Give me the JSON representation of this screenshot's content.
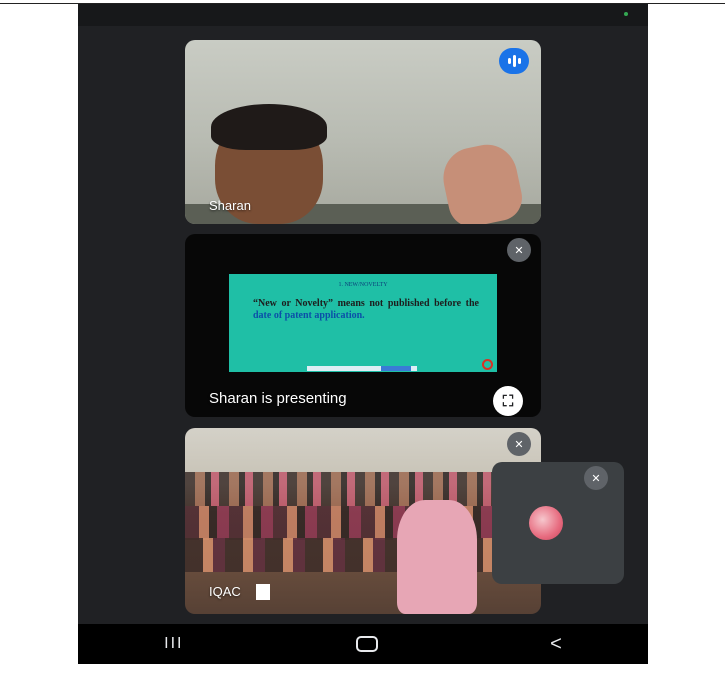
{
  "tiles": {
    "camera": {
      "participant": "Sharan"
    },
    "presentation": {
      "label": "Sharan is presenting",
      "slide": {
        "title": "1. NEW/NOVELTY",
        "text_bold": "“New or Novelty” means not published before the",
        "text_highlight": "date of patent application."
      },
      "fullscreen_icon": "fullscreen-icon"
    },
    "room": {
      "participant": "IQAC"
    }
  },
  "self_view": {
    "status": "muted"
  },
  "navbar": {
    "recent": "III",
    "back": "<"
  },
  "colors": {
    "background": "#202124",
    "accent": "#1a73e8",
    "slide": "#1fbfa6"
  }
}
